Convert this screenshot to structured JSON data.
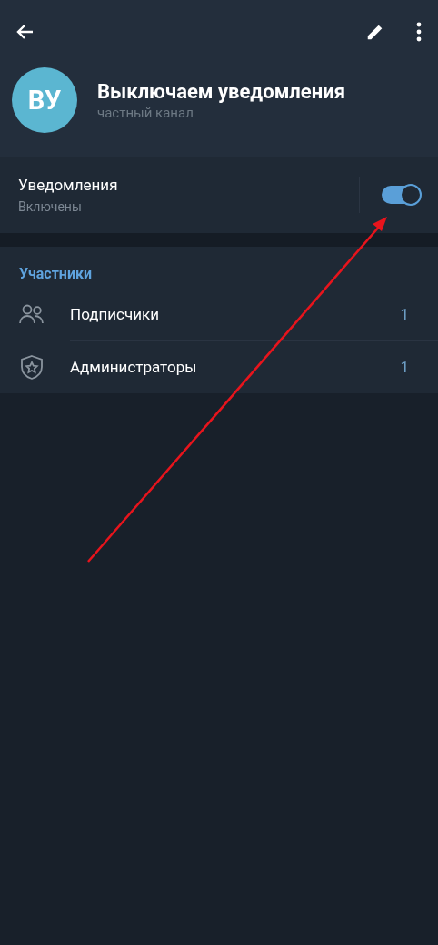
{
  "channel": {
    "avatar_initials": "ВУ",
    "title": "Выключаем уведомления",
    "subtitle": "частный канал"
  },
  "notifications": {
    "label": "Уведомления",
    "status": "Включены",
    "on": true
  },
  "members": {
    "title": "Участники",
    "rows": [
      {
        "kind": "people",
        "label": "Подписчики",
        "count": "1"
      },
      {
        "kind": "shield",
        "label": "Администраторы",
        "count": "1"
      }
    ]
  },
  "annotation": {
    "kind": "arrow"
  }
}
